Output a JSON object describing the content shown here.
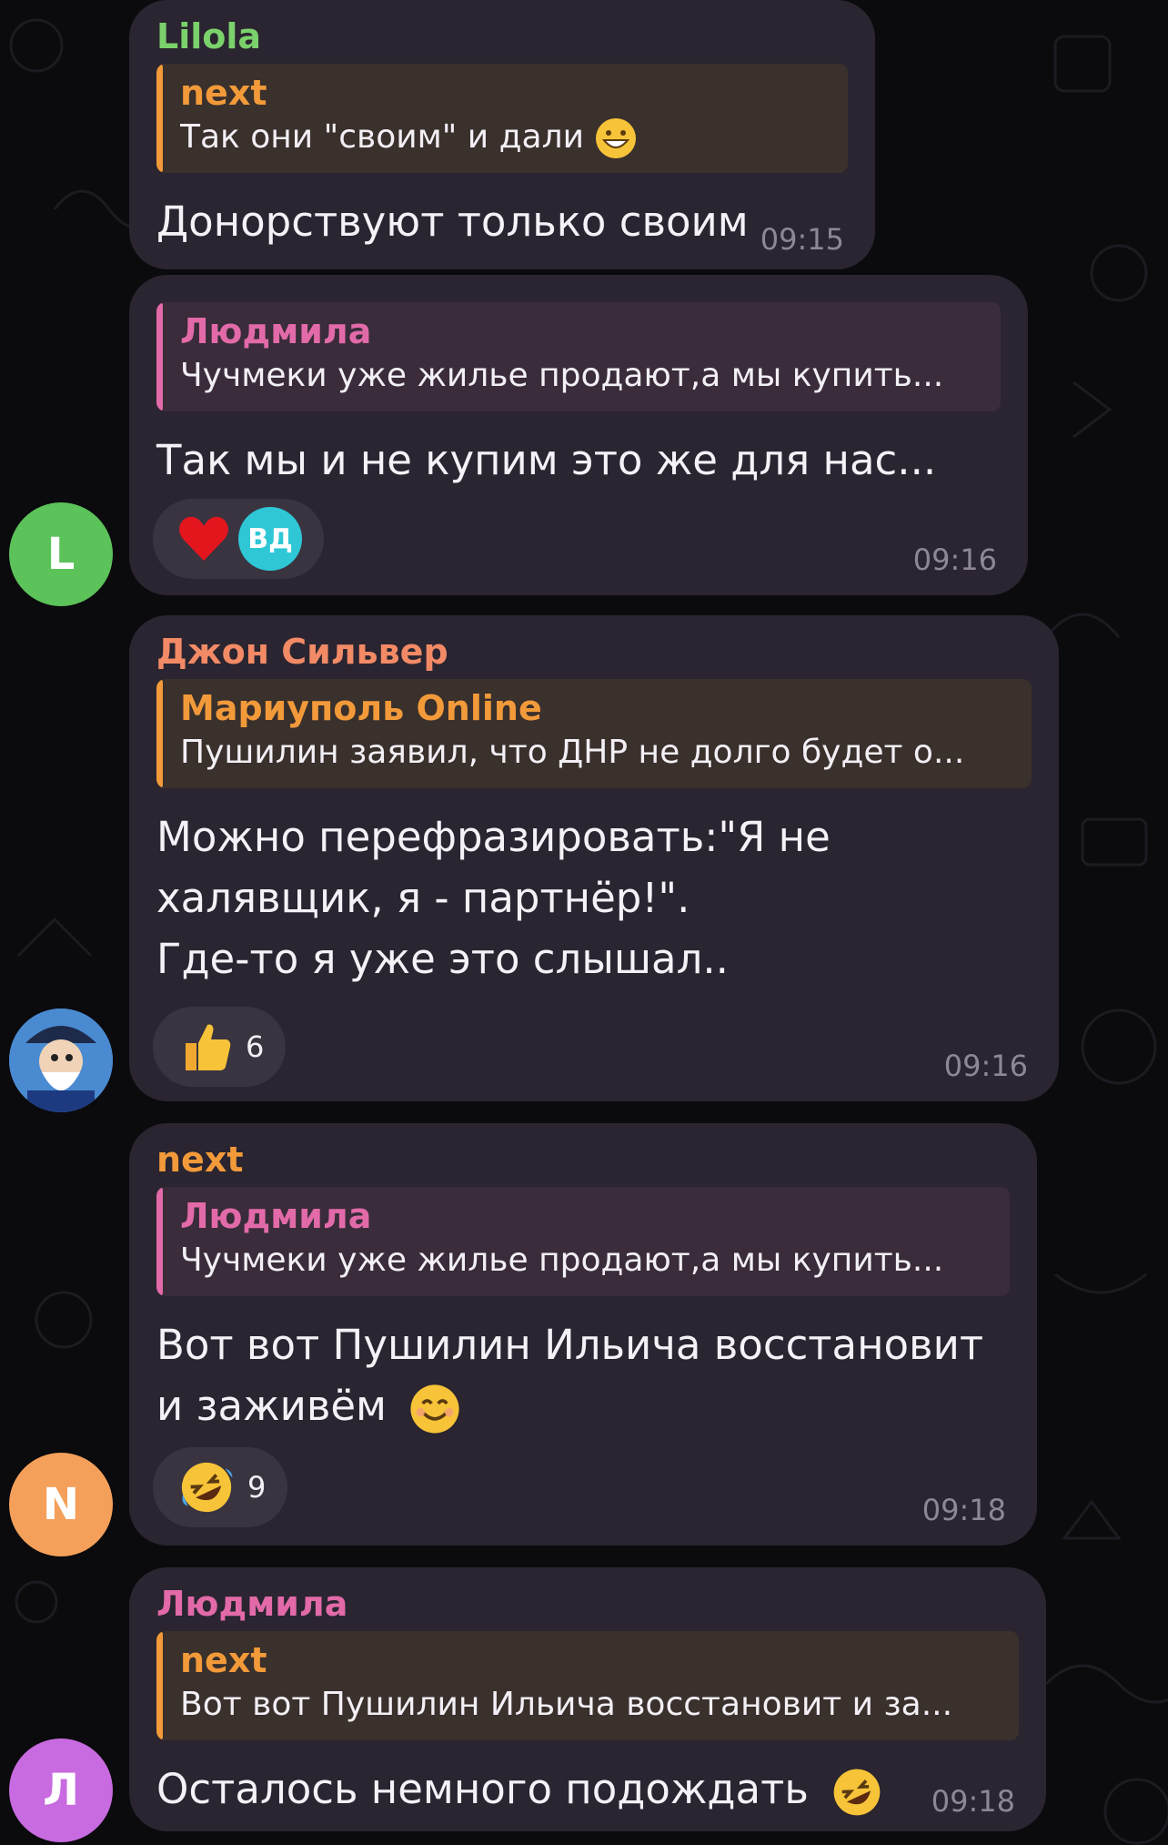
{
  "theme": {
    "background": "#0b0a0d",
    "bubble": "#2a2530",
    "reaction_pill": "#3a3440",
    "text": "#f4f1f7",
    "time": "#8e8894"
  },
  "messages": [
    {
      "sender": "Lilola",
      "sender_color": "#7bd16b",
      "reply": {
        "name": "next",
        "name_color": "#f29a3a",
        "bar_color": "#f29a3a",
        "bg": "#3a302c",
        "text": "Так они \"своим\" и дали"
      },
      "lines": [
        "Донорствуют только своим"
      ],
      "time": "09:15"
    },
    {
      "sender": "",
      "reply": {
        "name": "Людмила",
        "name_color": "#e26aa8",
        "bar_color": "#e26aa8",
        "bg": "#3a2c3a",
        "text": "Чучмеки уже жилье продают,а мы купить..."
      },
      "lines": [
        "Так мы и не купим это же для нас..."
      ],
      "time": "09:16",
      "reaction": {
        "icon": "heart-icon",
        "user_initials": "ВД"
      },
      "avatar": {
        "letter": "L",
        "color": "#5cc25a"
      }
    },
    {
      "sender": "Джон Сильвер",
      "sender_color": "#f28a66",
      "reply": {
        "name": "Мариуполь Online",
        "name_color": "#f29a3a",
        "bar_color": "#f29a3a",
        "bg": "#3a302c",
        "text": "Пушилин заявил, что ДНР не долго будет о..."
      },
      "lines": [
        "Можно перефразировать:\"Я не",
        "халявщик, я - партнёр!\".",
        "Где-то я уже это слышал.."
      ],
      "time": "09:16",
      "reaction": {
        "icon": "thumbs-up-icon",
        "count": "6"
      },
      "avatar": {
        "icon": "pirate-avatar-icon"
      }
    },
    {
      "sender": "next",
      "sender_color": "#f29a3a",
      "reply": {
        "name": "Людмила",
        "name_color": "#e26aa8",
        "bar_color": "#e26aa8",
        "bg": "#3a2c3a",
        "text": "Чучмеки уже жилье продают,а мы купить..."
      },
      "lines": [
        "Вот вот  Пушилин Ильича восстановит",
        "и заживём"
      ],
      "time": "09:18",
      "reaction": {
        "icon": "rofl-icon",
        "count": "9"
      },
      "avatar": {
        "letter": "N",
        "color": "#f5a05a"
      }
    },
    {
      "sender": "Людмила",
      "sender_color": "#e26aa8",
      "reply": {
        "name": "next",
        "name_color": "#f29a3a",
        "bar_color": "#f29a3a",
        "bg": "#3a302c",
        "text": "Вот вот Пушилин Ильича восстановит и за..."
      },
      "lines": [
        "Осталось немного подождать"
      ],
      "time": "09:18",
      "avatar": {
        "letter": "Л",
        "color": "#c86be0"
      }
    }
  ]
}
